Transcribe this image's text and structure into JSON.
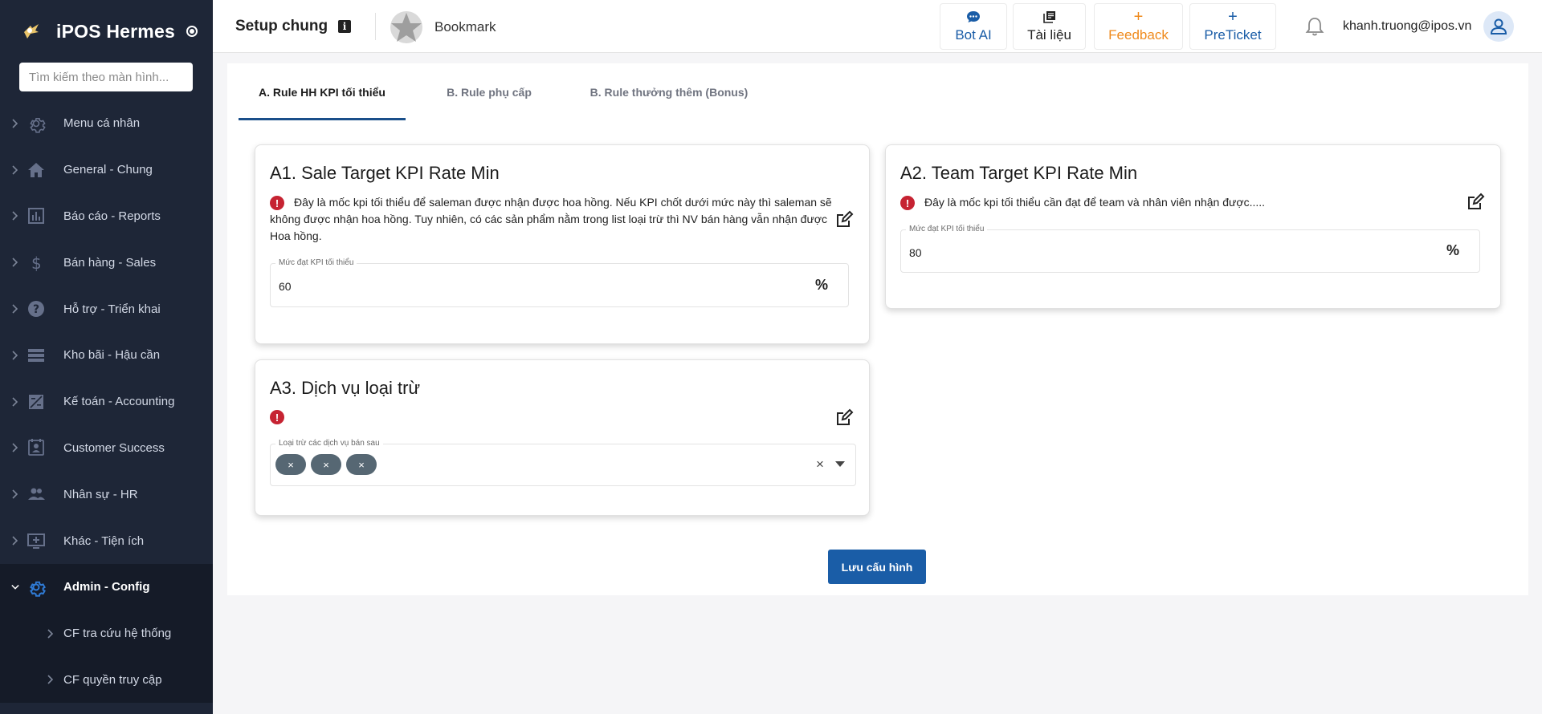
{
  "app": {
    "name": "iPOS Hermes"
  },
  "search": {
    "placeholder": "Tìm kiếm theo màn hình..."
  },
  "sidebar": {
    "items": [
      {
        "label": "Menu cá nhân",
        "icon": "gear-icon"
      },
      {
        "label": "General - Chung",
        "icon": "home-icon"
      },
      {
        "label": "Báo cáo - Reports",
        "icon": "bar-chart-icon"
      },
      {
        "label": "Bán hàng - Sales",
        "icon": "dollar-icon"
      },
      {
        "label": "Hỗ trợ - Triển khai",
        "icon": "help-icon"
      },
      {
        "label": "Kho bãi - Hậu cần",
        "icon": "storage-icon"
      },
      {
        "label": "Kế toán - Accounting",
        "icon": "calculator-icon"
      },
      {
        "label": "Customer Success",
        "icon": "contact-card-icon"
      },
      {
        "label": "Nhân sự - HR",
        "icon": "people-icon"
      },
      {
        "label": "Khác - Tiện ích",
        "icon": "add-box-icon"
      },
      {
        "label": "Admin - Config",
        "icon": "gear-icon",
        "active": true
      }
    ],
    "subitems": [
      {
        "label": "CF tra cứu hệ thống"
      },
      {
        "label": "CF quyền truy cập"
      }
    ]
  },
  "header": {
    "title": "Setup chung",
    "bookmark_label": "Bookmark",
    "buttons": [
      {
        "label": "Bot AI",
        "icon": "chat-icon",
        "color": "#1a5da7"
      },
      {
        "label": "Tài liệu",
        "icon": "library-icon",
        "color": "#222222"
      },
      {
        "label": "Feedback",
        "icon": "plus-icon",
        "color": "#ef8a1c"
      },
      {
        "label": "PreTicket",
        "icon": "plus-icon",
        "color": "#1a5da7"
      }
    ],
    "user_email": "khanh.truong@ipos.vn"
  },
  "tabs": [
    {
      "label": "A. Rule HH KPI tối thiểu",
      "active": true
    },
    {
      "label": "B. Rule phụ cấp"
    },
    {
      "label": "B. Rule thưởng thêm (Bonus)"
    }
  ],
  "cards": {
    "a1": {
      "title": "A1. Sale Target KPI Rate Min",
      "description": "Đây là mốc kpi tối thiểu để saleman được nhận được hoa hồng. Nếu KPI chốt dưới mức này thì saleman sẽ không được nhận hoa hồng. Tuy nhiên, có các sản phẩm nằm trong list loại trừ thì NV bán hàng vẫn nhận được Hoa hồng.",
      "field_label": "Mức đạt KPI tối thiểu",
      "field_value": "60",
      "unit": "%"
    },
    "a2": {
      "title": "A2. Team Target KPI Rate Min",
      "description": "Đây là mốc kpi tối thiểu cần đạt để team và nhân viên nhận được.....",
      "field_label": "Mức đạt KPI tối thiểu",
      "field_value": "80",
      "unit": "%"
    },
    "a3": {
      "title": "A3. Dịch vụ loại trừ",
      "field_label": "Loại trừ các dịch vụ bán sau",
      "chips": [
        "×",
        "×",
        "×"
      ],
      "clear": "×"
    }
  },
  "save_button": "Lưu cấu hình",
  "colors": {
    "sidebar_bg": "#1e2637",
    "primary": "#1a5da7",
    "error": "#c62332",
    "feedback": "#ef8a1c",
    "chip": "#566773"
  }
}
